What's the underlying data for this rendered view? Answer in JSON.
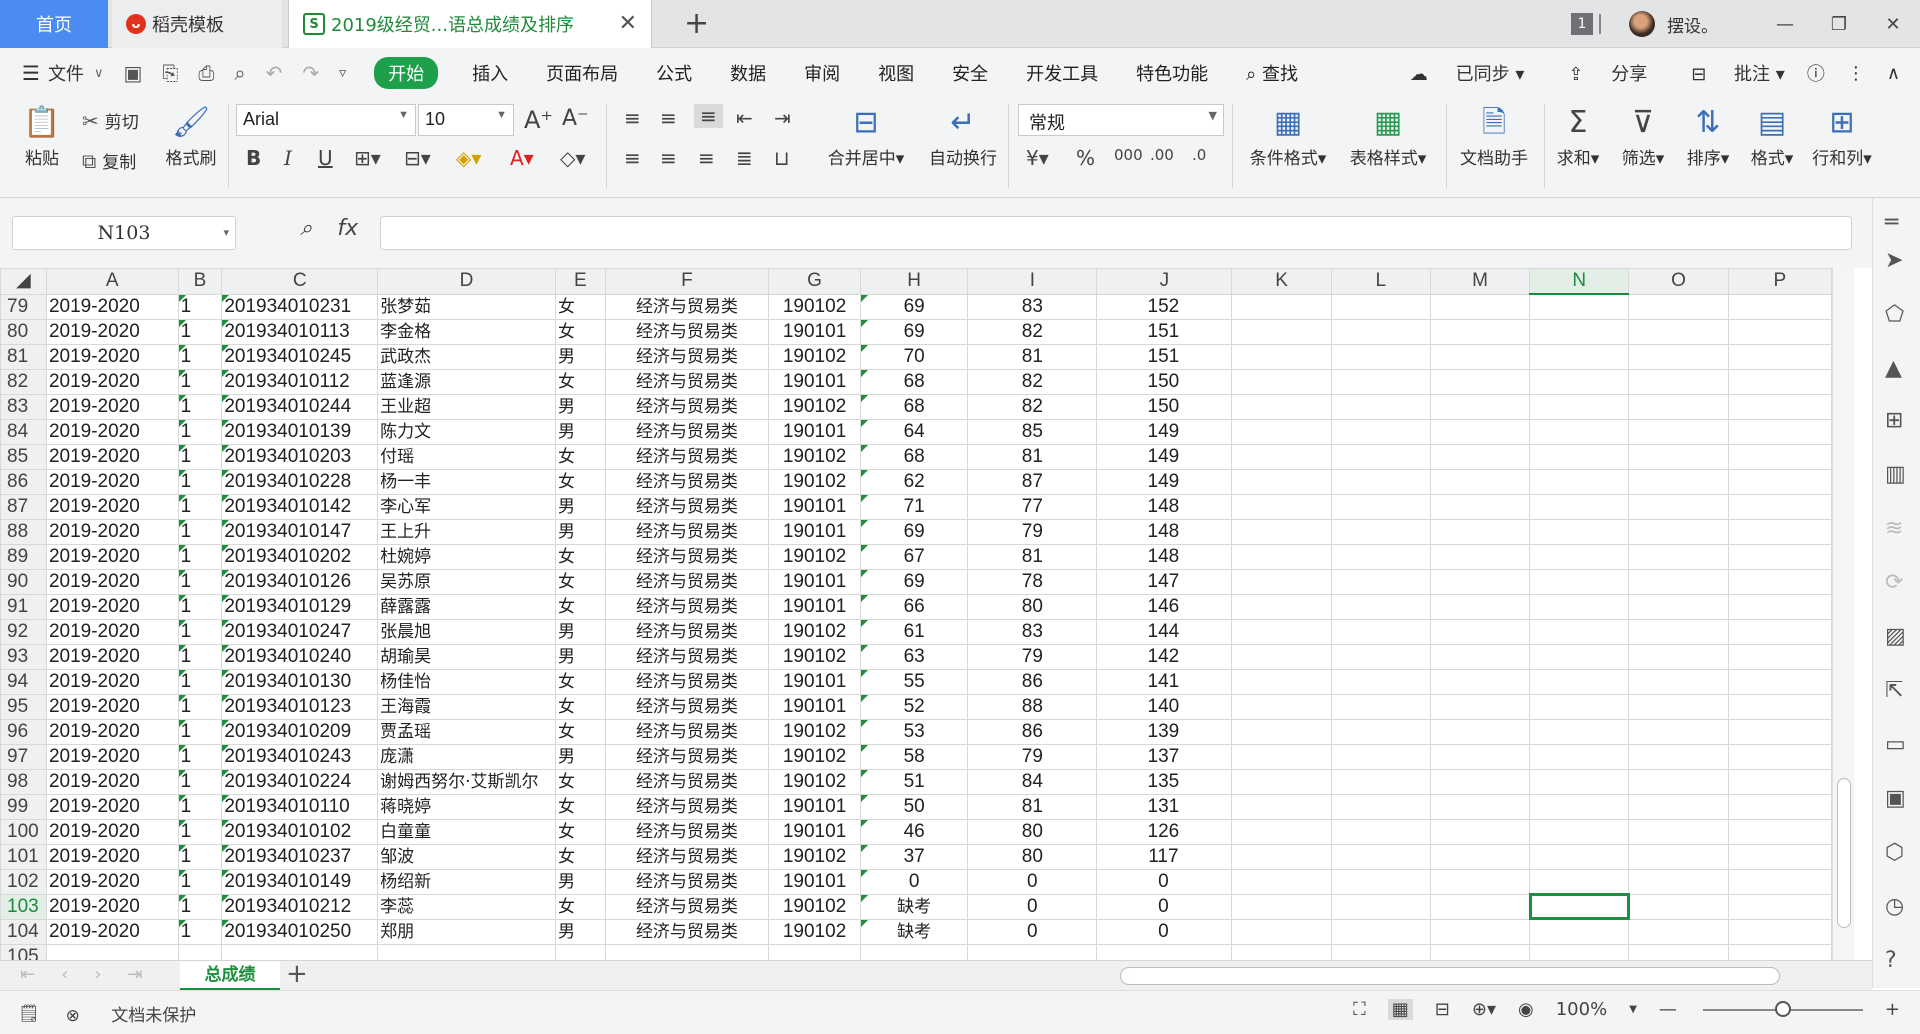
{
  "tabs": {
    "home": "首页",
    "template": "稻壳模板",
    "document": "2019级经贸...语总成绩及排序"
  },
  "window": {
    "badge": "1",
    "user": "摆设。"
  },
  "menu": {
    "file": "文件",
    "tabs": [
      "开始",
      "插入",
      "页面布局",
      "公式",
      "数据",
      "审阅",
      "视图",
      "安全",
      "开发工具",
      "特色功能"
    ],
    "search": "查找",
    "sync": "已同步",
    "share": "分享",
    "comment": "批注"
  },
  "ribbon": {
    "paste": "粘贴",
    "cut": "剪切",
    "copy": "复制",
    "format_painter": "格式刷",
    "font_name": "Arial",
    "font_size": "10",
    "merge_center": "合并居中",
    "wrap_text": "自动换行",
    "number_format": "常规",
    "conditional_format": "条件格式",
    "table_style": "表格样式",
    "doc_assistant": "文档助手",
    "sum": "求和",
    "filter": "筛选",
    "sort": "排序",
    "format": "格式",
    "rows_cols": "行和列"
  },
  "formula_bar": {
    "cell_ref": "N103",
    "content": ""
  },
  "sheet": {
    "columns": [
      "A",
      "B",
      "C",
      "D",
      "E",
      "F",
      "G",
      "H",
      "I",
      "J",
      "K",
      "L",
      "M",
      "N",
      "O",
      "P"
    ],
    "selected_column": "N",
    "selected_row": "103",
    "rows": [
      {
        "n": "79",
        "a": "2019-2020",
        "b": "1",
        "c": "201934010231",
        "d": "张梦茹",
        "e": "女",
        "f": "经济与贸易类",
        "g": "190102",
        "h": "69",
        "i": "83",
        "j": "152"
      },
      {
        "n": "80",
        "a": "2019-2020",
        "b": "1",
        "c": "201934010113",
        "d": "李金格",
        "e": "女",
        "f": "经济与贸易类",
        "g": "190101",
        "h": "69",
        "i": "82",
        "j": "151"
      },
      {
        "n": "81",
        "a": "2019-2020",
        "b": "1",
        "c": "201934010245",
        "d": "武政杰",
        "e": "男",
        "f": "经济与贸易类",
        "g": "190102",
        "h": "70",
        "i": "81",
        "j": "151"
      },
      {
        "n": "82",
        "a": "2019-2020",
        "b": "1",
        "c": "201934010112",
        "d": "蓝逢源",
        "e": "女",
        "f": "经济与贸易类",
        "g": "190101",
        "h": "68",
        "i": "82",
        "j": "150"
      },
      {
        "n": "83",
        "a": "2019-2020",
        "b": "1",
        "c": "201934010244",
        "d": "王业超",
        "e": "男",
        "f": "经济与贸易类",
        "g": "190102",
        "h": "68",
        "i": "82",
        "j": "150"
      },
      {
        "n": "84",
        "a": "2019-2020",
        "b": "1",
        "c": "201934010139",
        "d": "陈力文",
        "e": "男",
        "f": "经济与贸易类",
        "g": "190101",
        "h": "64",
        "i": "85",
        "j": "149"
      },
      {
        "n": "85",
        "a": "2019-2020",
        "b": "1",
        "c": "201934010203",
        "d": "付瑶",
        "e": "女",
        "f": "经济与贸易类",
        "g": "190102",
        "h": "68",
        "i": "81",
        "j": "149"
      },
      {
        "n": "86",
        "a": "2019-2020",
        "b": "1",
        "c": "201934010228",
        "d": "杨一丰",
        "e": "女",
        "f": "经济与贸易类",
        "g": "190102",
        "h": "62",
        "i": "87",
        "j": "149"
      },
      {
        "n": "87",
        "a": "2019-2020",
        "b": "1",
        "c": "201934010142",
        "d": "李心军",
        "e": "男",
        "f": "经济与贸易类",
        "g": "190101",
        "h": "71",
        "i": "77",
        "j": "148"
      },
      {
        "n": "88",
        "a": "2019-2020",
        "b": "1",
        "c": "201934010147",
        "d": "王上升",
        "e": "男",
        "f": "经济与贸易类",
        "g": "190101",
        "h": "69",
        "i": "79",
        "j": "148"
      },
      {
        "n": "89",
        "a": "2019-2020",
        "b": "1",
        "c": "201934010202",
        "d": "杜婉婷",
        "e": "女",
        "f": "经济与贸易类",
        "g": "190102",
        "h": "67",
        "i": "81",
        "j": "148"
      },
      {
        "n": "90",
        "a": "2019-2020",
        "b": "1",
        "c": "201934010126",
        "d": "吴苏原",
        "e": "女",
        "f": "经济与贸易类",
        "g": "190101",
        "h": "69",
        "i": "78",
        "j": "147"
      },
      {
        "n": "91",
        "a": "2019-2020",
        "b": "1",
        "c": "201934010129",
        "d": "薛露露",
        "e": "女",
        "f": "经济与贸易类",
        "g": "190101",
        "h": "66",
        "i": "80",
        "j": "146"
      },
      {
        "n": "92",
        "a": "2019-2020",
        "b": "1",
        "c": "201934010247",
        "d": "张晨旭",
        "e": "男",
        "f": "经济与贸易类",
        "g": "190102",
        "h": "61",
        "i": "83",
        "j": "144"
      },
      {
        "n": "93",
        "a": "2019-2020",
        "b": "1",
        "c": "201934010240",
        "d": "胡瑜昊",
        "e": "男",
        "f": "经济与贸易类",
        "g": "190102",
        "h": "63",
        "i": "79",
        "j": "142"
      },
      {
        "n": "94",
        "a": "2019-2020",
        "b": "1",
        "c": "201934010130",
        "d": "杨佳怡",
        "e": "女",
        "f": "经济与贸易类",
        "g": "190101",
        "h": "55",
        "i": "86",
        "j": "141"
      },
      {
        "n": "95",
        "a": "2019-2020",
        "b": "1",
        "c": "201934010123",
        "d": "王海霞",
        "e": "女",
        "f": "经济与贸易类",
        "g": "190101",
        "h": "52",
        "i": "88",
        "j": "140"
      },
      {
        "n": "96",
        "a": "2019-2020",
        "b": "1",
        "c": "201934010209",
        "d": "贾孟瑶",
        "e": "女",
        "f": "经济与贸易类",
        "g": "190102",
        "h": "53",
        "i": "86",
        "j": "139"
      },
      {
        "n": "97",
        "a": "2019-2020",
        "b": "1",
        "c": "201934010243",
        "d": "庞潇",
        "e": "男",
        "f": "经济与贸易类",
        "g": "190102",
        "h": "58",
        "i": "79",
        "j": "137"
      },
      {
        "n": "98",
        "a": "2019-2020",
        "b": "1",
        "c": "201934010224",
        "d": "谢姆西努尔·艾斯凯尔",
        "e": "女",
        "f": "经济与贸易类",
        "g": "190102",
        "h": "51",
        "i": "84",
        "j": "135"
      },
      {
        "n": "99",
        "a": "2019-2020",
        "b": "1",
        "c": "201934010110",
        "d": "蒋晓婷",
        "e": "女",
        "f": "经济与贸易类",
        "g": "190101",
        "h": "50",
        "i": "81",
        "j": "131"
      },
      {
        "n": "100",
        "a": "2019-2020",
        "b": "1",
        "c": "201934010102",
        "d": "白童童",
        "e": "女",
        "f": "经济与贸易类",
        "g": "190101",
        "h": "46",
        "i": "80",
        "j": "126"
      },
      {
        "n": "101",
        "a": "2019-2020",
        "b": "1",
        "c": "201934010237",
        "d": "邹波",
        "e": "女",
        "f": "经济与贸易类",
        "g": "190102",
        "h": "37",
        "i": "80",
        "j": "117"
      },
      {
        "n": "102",
        "a": "2019-2020",
        "b": "1",
        "c": "201934010149",
        "d": "杨绍新",
        "e": "男",
        "f": "经济与贸易类",
        "g": "190101",
        "h": "0",
        "i": "0",
        "j": "0"
      },
      {
        "n": "103",
        "a": "2019-2020",
        "b": "1",
        "c": "201934010212",
        "d": "李蕊",
        "e": "女",
        "f": "经济与贸易类",
        "g": "190102",
        "h": "缺考",
        "i": "0",
        "j": "0"
      },
      {
        "n": "104",
        "a": "2019-2020",
        "b": "1",
        "c": "201934010250",
        "d": "郑朋",
        "e": "男",
        "f": "经济与贸易类",
        "g": "190102",
        "h": "缺考",
        "i": "0",
        "j": "0"
      },
      {
        "n": "105",
        "a": "",
        "b": "",
        "c": "",
        "d": "",
        "e": "",
        "f": "",
        "g": "",
        "h": "",
        "i": "",
        "j": ""
      }
    ],
    "sheet_tab": "总成绩"
  },
  "status": {
    "protection": "文档未保护",
    "zoom": "100%",
    "zoom_level": 0.5
  },
  "colors": {
    "accent": "#1ea04b",
    "home_tab": "#4a8cf0",
    "selection": "#1d8f3f"
  }
}
